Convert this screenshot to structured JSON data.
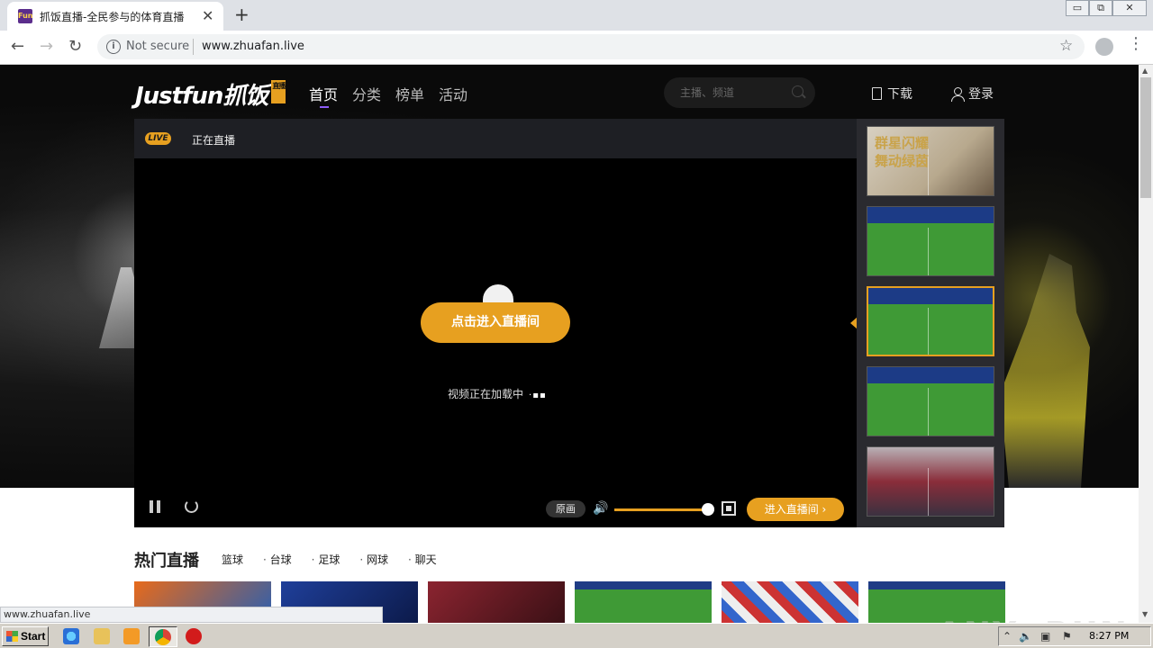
{
  "browser": {
    "tab_title": "抓饭直播-全民参与的体育直播",
    "tab_favicon": "Fun",
    "close_tab": "✕",
    "new_tab": "+",
    "security_label": "Not secure",
    "url": "www.zhuafan.live",
    "window_controls": {
      "minimize": "▭",
      "maximize": "⧉",
      "close": "✕"
    }
  },
  "site": {
    "logo_text": "Justfun抓饭",
    "logo_badge": "直播",
    "nav": [
      {
        "label": "首页",
        "active": true
      },
      {
        "label": "分类",
        "active": false
      },
      {
        "label": "榜单",
        "active": false
      },
      {
        "label": "活动",
        "active": false
      }
    ],
    "search_placeholder": "主播、频道",
    "download_label": "下载",
    "login_label": "登录"
  },
  "player": {
    "live_badge": "LIVE",
    "status": "正在直播",
    "enter_room_big": "点击进入直播间",
    "loading_text": "视频正在加载中",
    "loading_dots": "·▪▪",
    "quality": "原画",
    "volume_icon": "🔊",
    "volume_level": 0.95,
    "enter_room_small": "进入直播间 ›"
  },
  "side_thumbs": [
    {
      "kind": "promo",
      "text": "群星闪耀\n舞动绿茵"
    },
    {
      "kind": "soccer"
    },
    {
      "kind": "soccer",
      "active": true
    },
    {
      "kind": "soccer"
    },
    {
      "kind": "stadium"
    }
  ],
  "hot": {
    "title": "热门直播",
    "categories": [
      "篮球",
      "台球",
      "足球",
      "网球",
      "聊天"
    ]
  },
  "status_bar": "www.zhuafan.live",
  "watermark": "ANY▷RUN",
  "taskbar": {
    "start_label": "Start",
    "time": "8:27 PM"
  },
  "colors": {
    "accent": "#e7a020",
    "nav_underline": "#8d5cf6"
  }
}
